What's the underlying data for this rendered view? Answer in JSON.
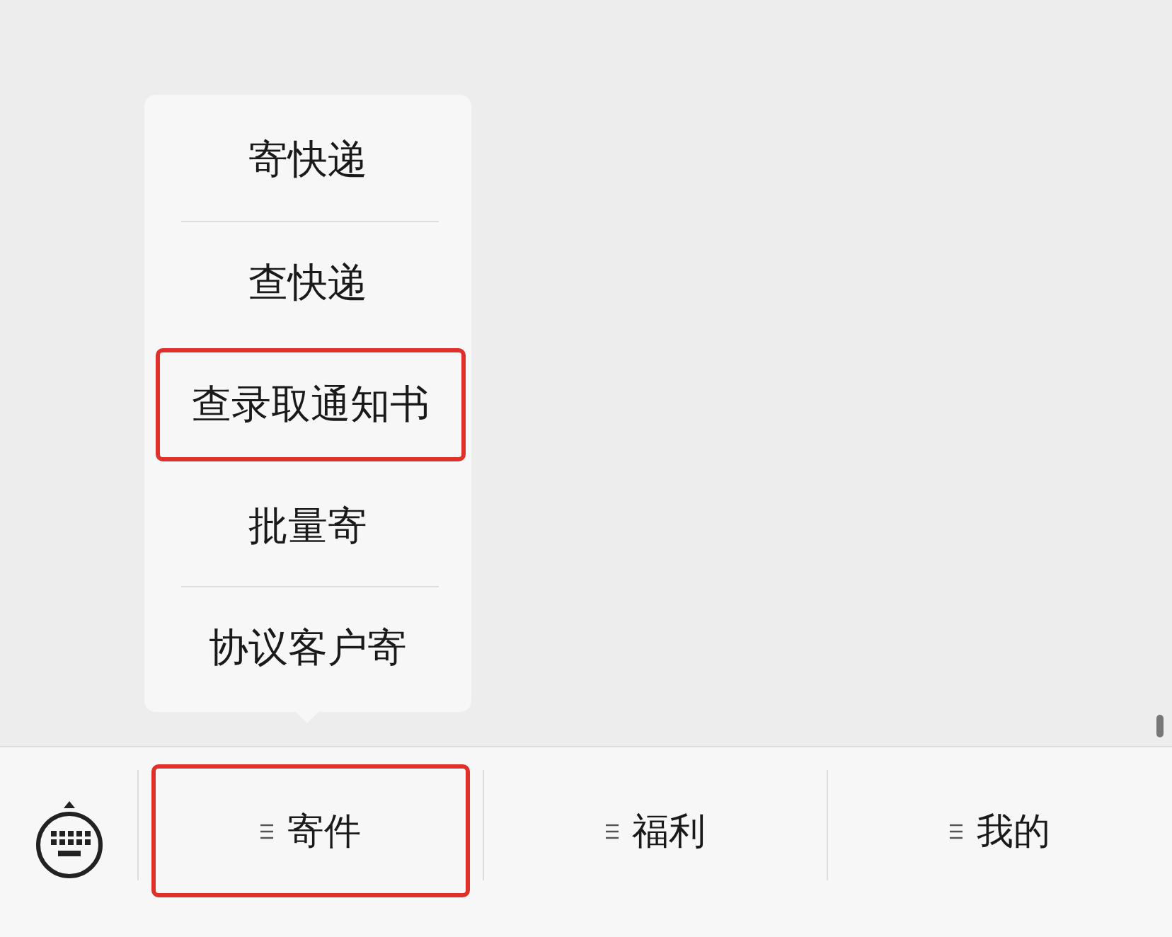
{
  "popup_menu": {
    "items": [
      {
        "label": "寄快递",
        "highlighted": false
      },
      {
        "label": "查快递",
        "highlighted": false
      },
      {
        "label": "查录取通知书",
        "highlighted": true
      },
      {
        "label": "批量寄",
        "highlighted": false
      },
      {
        "label": "协议客户寄",
        "highlighted": false
      }
    ]
  },
  "menu_bar": {
    "tabs": [
      {
        "label": "寄件",
        "highlighted": true
      },
      {
        "label": "福利",
        "highlighted": false
      },
      {
        "label": "我的",
        "highlighted": false
      }
    ]
  }
}
